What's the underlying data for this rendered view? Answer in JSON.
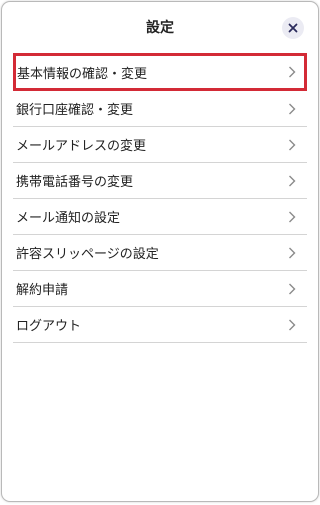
{
  "header": {
    "title": "設定"
  },
  "menu": {
    "items": [
      {
        "label": "基本情報の確認・変更",
        "highlighted": true
      },
      {
        "label": "銀行口座確認・変更"
      },
      {
        "label": "メールアドレスの変更"
      },
      {
        "label": "携帯電話番号の変更"
      },
      {
        "label": "メール通知の設定"
      },
      {
        "label": "許容スリッページの設定"
      },
      {
        "label": "解約申請"
      },
      {
        "label": "ログアウト"
      }
    ]
  },
  "colors": {
    "highlight_border": "#d32a36",
    "close_button_bg": "#ebebf3"
  },
  "icons": {
    "close": "close-icon",
    "item_arrow": "chevron-right-icon"
  }
}
